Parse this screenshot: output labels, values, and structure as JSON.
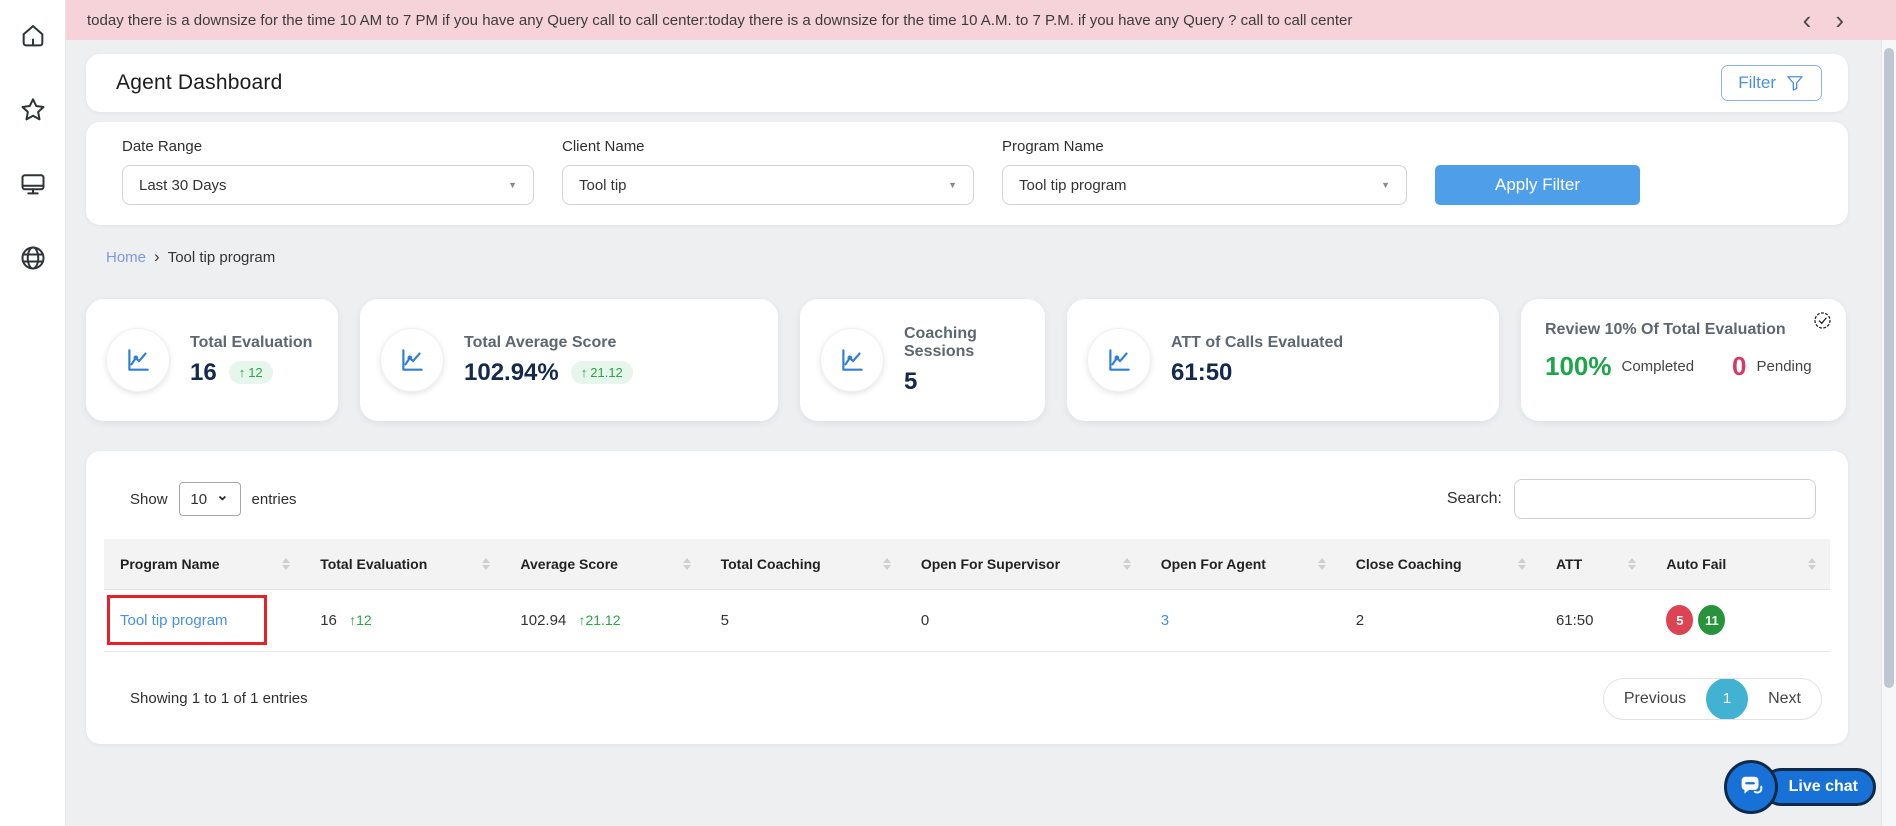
{
  "glyphs": {
    "up_arrow": "↑",
    "chevron_left": "‹",
    "chevron_right": "›",
    "caret_down": "▼",
    "select_chevron": "⌄"
  },
  "banner": {
    "text": "today there is a downsize for the time 10 AM to 7 PM if you have any Query call to call center:today there is a downsize for the time 10 A.M. to 7 P.M. if you have any Query ? call to call center"
  },
  "sidebar": {
    "items": [
      {
        "icon": "home-icon"
      },
      {
        "icon": "star-icon"
      },
      {
        "icon": "monitor-icon"
      },
      {
        "icon": "globe-icon"
      }
    ]
  },
  "header": {
    "title": "Agent Dashboard",
    "filter_button": "Filter"
  },
  "filters": {
    "fields": [
      {
        "label": "Date Range",
        "value": "Last 30 Days"
      },
      {
        "label": "Client Name",
        "value": "Tool tip"
      },
      {
        "label": "Program Name",
        "value": "Tool tip program"
      }
    ],
    "apply_button": "Apply Filter"
  },
  "breadcrumb": {
    "home": "Home",
    "separator": "›",
    "current": "Tool tip program"
  },
  "stat_cards": [
    {
      "title": "Total Evaluation",
      "value": "16",
      "delta": "12"
    },
    {
      "title": "Total Average Score",
      "value": "102.94%",
      "delta": "21.12"
    },
    {
      "title": "Coaching Sessions",
      "value": "5"
    },
    {
      "title": "ATT of Calls Evaluated",
      "value": "61:50"
    },
    {
      "title": "Review 10% Of Total Evaluation",
      "completed_value": "100%",
      "completed_label": "Completed",
      "pending_value": "0",
      "pending_label": "Pending"
    }
  ],
  "table": {
    "show_label": "Show",
    "page_size": "10",
    "entries_label": "entries",
    "search_label": "Search:",
    "columns": [
      "Program Name",
      "Total Evaluation",
      "Average Score",
      "Total Coaching",
      "Open For Supervisor",
      "Open For Agent",
      "Close Coaching",
      "ATT",
      "Auto Fail"
    ],
    "row": {
      "program_name": "Tool tip program",
      "total_evaluation": "16",
      "total_evaluation_delta": "12",
      "average_score": "102.94",
      "average_score_delta": "21.12",
      "total_coaching": "5",
      "open_for_supervisor": "0",
      "open_for_agent": "3",
      "close_coaching": "2",
      "att": "61:50",
      "auto_fail_red": "5",
      "auto_fail_green": "11"
    },
    "footer": {
      "showing_text": "Showing 1 to 1 of 1 entries",
      "previous": "Previous",
      "page": "1",
      "next": "Next"
    }
  },
  "live_chat": {
    "label": "Live chat"
  },
  "colors": {
    "banner_pink": "#f6d3d8",
    "accent_blue": "#4f9ee9",
    "link_blue": "#4a90e2",
    "breadcrumb_blue": "#7d98e0",
    "value_navy": "#13294e",
    "green": "#28a745",
    "completed_green": "#1ea549",
    "pending_red": "#d23a6a",
    "badge_red": "#dc4353",
    "badge_green": "#27943b",
    "pagination_teal": "#41b2d2",
    "livechat_blue": "#1771d6"
  }
}
